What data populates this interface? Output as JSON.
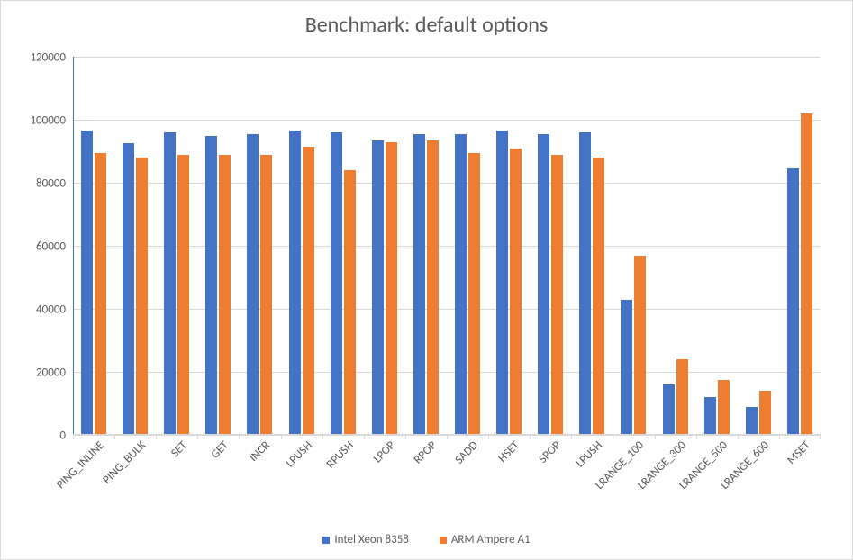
{
  "chart_data": {
    "type": "bar",
    "title": "Benchmark: default options",
    "xlabel": "",
    "ylabel": "",
    "ylim": [
      0,
      120000
    ],
    "ystep": 20000,
    "categories": [
      "PING_INLINE",
      "PING_BULK",
      "SET",
      "GET",
      "INCR",
      "LPUSH",
      "RPUSH",
      "LPOP",
      "RPOP",
      "SADD",
      "HSET",
      "SPOP",
      "LPUSH",
      "LRANGE_100",
      "LRANGE_300",
      "LRANGE_500",
      "LRANGE_600",
      "MSET"
    ],
    "series": [
      {
        "name": "Intel Xeon 8358",
        "color": "#4472c4",
        "values": [
          96500,
          92500,
          96000,
          95000,
          95500,
          96500,
          96000,
          93500,
          95500,
          95500,
          96500,
          95500,
          96000,
          43000,
          16000,
          12000,
          9000,
          84500
        ]
      },
      {
        "name": "ARM Ampere A1",
        "color": "#ed7d31",
        "values": [
          89500,
          88000,
          89000,
          89000,
          89000,
          91500,
          84000,
          93000,
          93500,
          89500,
          91000,
          89000,
          88000,
          57000,
          24000,
          17500,
          14000,
          102000
        ]
      }
    ]
  }
}
